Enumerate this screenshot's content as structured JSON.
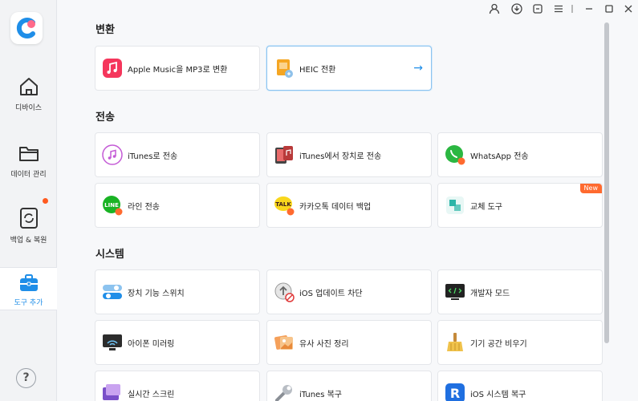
{
  "sidebar": {
    "items": [
      {
        "label": "디바이스"
      },
      {
        "label": "데이터 관리"
      },
      {
        "label": "백업 & 복원"
      },
      {
        "label": "도구 추가"
      }
    ],
    "help": "?"
  },
  "sections": {
    "convert": {
      "title": "변환",
      "cards": [
        {
          "label": "Apple Music을 MP3로 변환"
        },
        {
          "label": "HEIC 전환",
          "arrow": "→"
        }
      ]
    },
    "transfer": {
      "title": "전송",
      "cards": [
        {
          "label": "iTunes로 전송"
        },
        {
          "label": "iTunes에서 장치로 전송"
        },
        {
          "label": "WhatsApp 전송"
        },
        {
          "label": "라인 전송"
        },
        {
          "label": "카카오톡 데이터 백업"
        },
        {
          "label": "교체 도구",
          "badge": "New"
        }
      ]
    },
    "system": {
      "title": "시스템",
      "cards": [
        {
          "label": "장치 기능 스위치"
        },
        {
          "label": "iOS 업데이트 차단"
        },
        {
          "label": "개발자 모드"
        },
        {
          "label": "아이폰 미러링"
        },
        {
          "label": "유사 사진 정리"
        },
        {
          "label": "기기 공간 비우기"
        },
        {
          "label": "실시간 스크린"
        },
        {
          "label": "iTunes 복구"
        },
        {
          "label": "iOS 시스템 복구"
        }
      ]
    }
  },
  "colors": {
    "accent": "#1f8ee8",
    "badge": "#ff6a2f"
  }
}
